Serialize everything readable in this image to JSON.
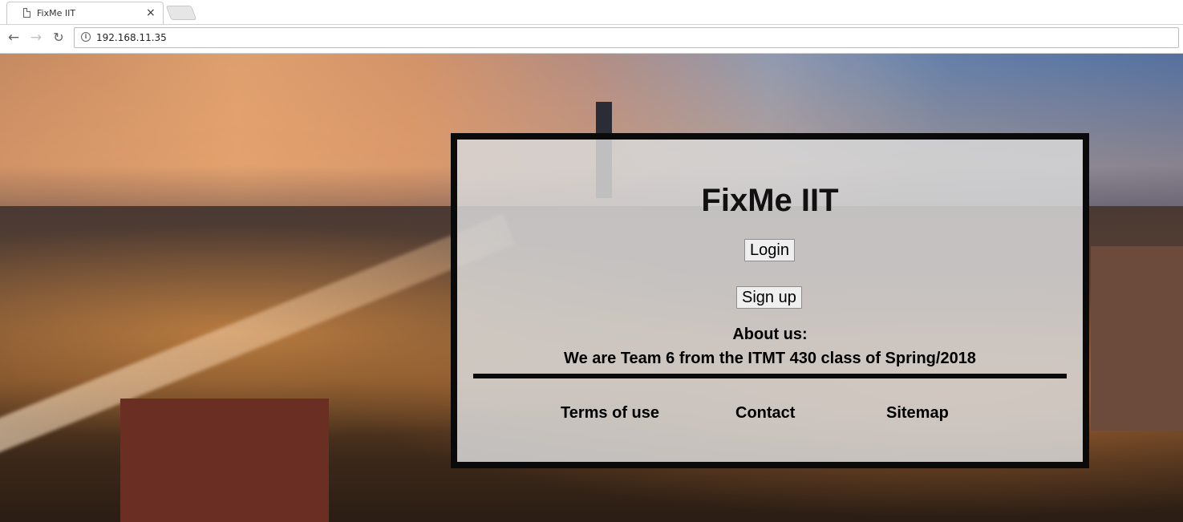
{
  "browser": {
    "tab_title": "FixMe IIT",
    "tab_close": "×",
    "url": "192.168.11.35",
    "icons": {
      "back": "arrow-left-icon",
      "forward": "arrow-right-icon",
      "reload": "reload-icon",
      "info": "info-icon",
      "page": "page-icon"
    },
    "glyphs": {
      "back": "←",
      "forward": "→",
      "reload": "↻",
      "info": "i"
    }
  },
  "page": {
    "title": "FixMe IIT",
    "login_label": "Login",
    "signup_label": "Sign up",
    "about_heading": "About us:",
    "about_text": "We are Team 6 from the ITMT 430 class of Spring/2018",
    "footer": {
      "terms": "Terms of use",
      "contact": "Contact",
      "sitemap": "Sitemap"
    }
  },
  "colors": {
    "panel_border": "#0a0a0a",
    "panel_background": "#d7d7d7",
    "text": "#000000"
  }
}
